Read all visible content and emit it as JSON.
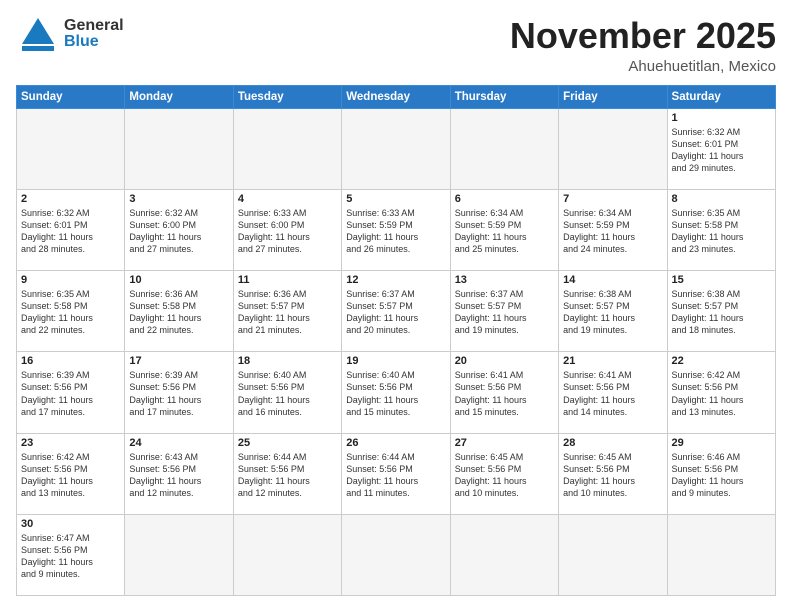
{
  "header": {
    "logo_general": "General",
    "logo_blue": "Blue",
    "month_title": "November 2025",
    "location": "Ahuehuetitlan, Mexico"
  },
  "calendar": {
    "days_of_week": [
      "Sunday",
      "Monday",
      "Tuesday",
      "Wednesday",
      "Thursday",
      "Friday",
      "Saturday"
    ],
    "weeks": [
      [
        {
          "day": "",
          "info": ""
        },
        {
          "day": "",
          "info": ""
        },
        {
          "day": "",
          "info": ""
        },
        {
          "day": "",
          "info": ""
        },
        {
          "day": "",
          "info": ""
        },
        {
          "day": "",
          "info": ""
        },
        {
          "day": "1",
          "info": "Sunrise: 6:32 AM\nSunset: 6:01 PM\nDaylight: 11 hours\nand 29 minutes."
        }
      ],
      [
        {
          "day": "2",
          "info": "Sunrise: 6:32 AM\nSunset: 6:01 PM\nDaylight: 11 hours\nand 28 minutes."
        },
        {
          "day": "3",
          "info": "Sunrise: 6:32 AM\nSunset: 6:00 PM\nDaylight: 11 hours\nand 27 minutes."
        },
        {
          "day": "4",
          "info": "Sunrise: 6:33 AM\nSunset: 6:00 PM\nDaylight: 11 hours\nand 27 minutes."
        },
        {
          "day": "5",
          "info": "Sunrise: 6:33 AM\nSunset: 5:59 PM\nDaylight: 11 hours\nand 26 minutes."
        },
        {
          "day": "6",
          "info": "Sunrise: 6:34 AM\nSunset: 5:59 PM\nDaylight: 11 hours\nand 25 minutes."
        },
        {
          "day": "7",
          "info": "Sunrise: 6:34 AM\nSunset: 5:59 PM\nDaylight: 11 hours\nand 24 minutes."
        },
        {
          "day": "8",
          "info": "Sunrise: 6:35 AM\nSunset: 5:58 PM\nDaylight: 11 hours\nand 23 minutes."
        }
      ],
      [
        {
          "day": "9",
          "info": "Sunrise: 6:35 AM\nSunset: 5:58 PM\nDaylight: 11 hours\nand 22 minutes."
        },
        {
          "day": "10",
          "info": "Sunrise: 6:36 AM\nSunset: 5:58 PM\nDaylight: 11 hours\nand 22 minutes."
        },
        {
          "day": "11",
          "info": "Sunrise: 6:36 AM\nSunset: 5:57 PM\nDaylight: 11 hours\nand 21 minutes."
        },
        {
          "day": "12",
          "info": "Sunrise: 6:37 AM\nSunset: 5:57 PM\nDaylight: 11 hours\nand 20 minutes."
        },
        {
          "day": "13",
          "info": "Sunrise: 6:37 AM\nSunset: 5:57 PM\nDaylight: 11 hours\nand 19 minutes."
        },
        {
          "day": "14",
          "info": "Sunrise: 6:38 AM\nSunset: 5:57 PM\nDaylight: 11 hours\nand 19 minutes."
        },
        {
          "day": "15",
          "info": "Sunrise: 6:38 AM\nSunset: 5:57 PM\nDaylight: 11 hours\nand 18 minutes."
        }
      ],
      [
        {
          "day": "16",
          "info": "Sunrise: 6:39 AM\nSunset: 5:56 PM\nDaylight: 11 hours\nand 17 minutes."
        },
        {
          "day": "17",
          "info": "Sunrise: 6:39 AM\nSunset: 5:56 PM\nDaylight: 11 hours\nand 17 minutes."
        },
        {
          "day": "18",
          "info": "Sunrise: 6:40 AM\nSunset: 5:56 PM\nDaylight: 11 hours\nand 16 minutes."
        },
        {
          "day": "19",
          "info": "Sunrise: 6:40 AM\nSunset: 5:56 PM\nDaylight: 11 hours\nand 15 minutes."
        },
        {
          "day": "20",
          "info": "Sunrise: 6:41 AM\nSunset: 5:56 PM\nDaylight: 11 hours\nand 15 minutes."
        },
        {
          "day": "21",
          "info": "Sunrise: 6:41 AM\nSunset: 5:56 PM\nDaylight: 11 hours\nand 14 minutes."
        },
        {
          "day": "22",
          "info": "Sunrise: 6:42 AM\nSunset: 5:56 PM\nDaylight: 11 hours\nand 13 minutes."
        }
      ],
      [
        {
          "day": "23",
          "info": "Sunrise: 6:42 AM\nSunset: 5:56 PM\nDaylight: 11 hours\nand 13 minutes."
        },
        {
          "day": "24",
          "info": "Sunrise: 6:43 AM\nSunset: 5:56 PM\nDaylight: 11 hours\nand 12 minutes."
        },
        {
          "day": "25",
          "info": "Sunrise: 6:44 AM\nSunset: 5:56 PM\nDaylight: 11 hours\nand 12 minutes."
        },
        {
          "day": "26",
          "info": "Sunrise: 6:44 AM\nSunset: 5:56 PM\nDaylight: 11 hours\nand 11 minutes."
        },
        {
          "day": "27",
          "info": "Sunrise: 6:45 AM\nSunset: 5:56 PM\nDaylight: 11 hours\nand 10 minutes."
        },
        {
          "day": "28",
          "info": "Sunrise: 6:45 AM\nSunset: 5:56 PM\nDaylight: 11 hours\nand 10 minutes."
        },
        {
          "day": "29",
          "info": "Sunrise: 6:46 AM\nSunset: 5:56 PM\nDaylight: 11 hours\nand 9 minutes."
        }
      ],
      [
        {
          "day": "30",
          "info": "Sunrise: 6:47 AM\nSunset: 5:56 PM\nDaylight: 11 hours\nand 9 minutes."
        },
        {
          "day": "",
          "info": ""
        },
        {
          "day": "",
          "info": ""
        },
        {
          "day": "",
          "info": ""
        },
        {
          "day": "",
          "info": ""
        },
        {
          "day": "",
          "info": ""
        },
        {
          "day": "",
          "info": ""
        }
      ]
    ]
  }
}
